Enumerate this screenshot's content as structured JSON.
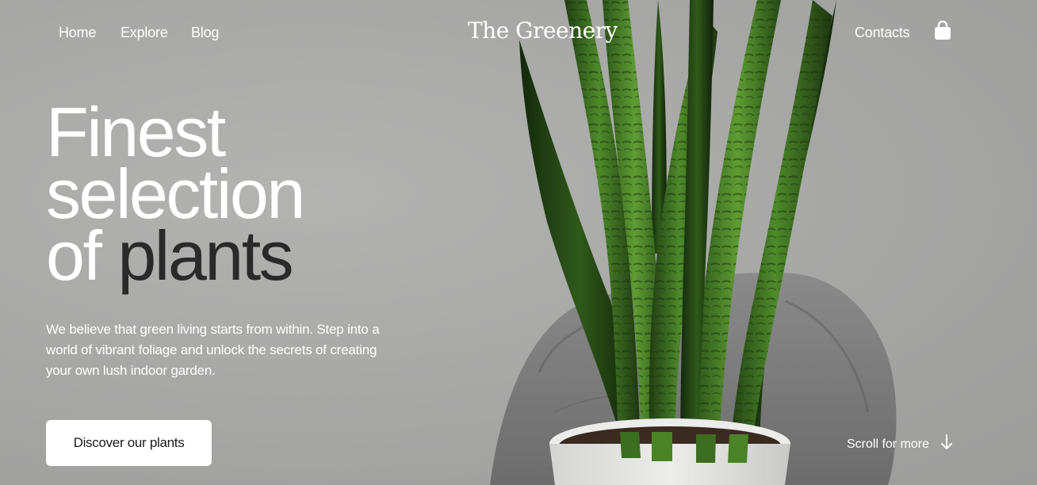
{
  "nav": {
    "home": "Home",
    "explore": "Explore",
    "blog": "Blog",
    "contacts": "Contacts"
  },
  "brand": "The Greenery",
  "hero": {
    "headline_line1": "Finest",
    "headline_line2": "selection",
    "headline_line3_light": "of ",
    "headline_line3_dark": "plants",
    "lead": "We believe that green living starts from within. Step into a world of vibrant foliage and unlock the secrets of creating your own lush indoor garden.",
    "cta_label": "Discover our plants",
    "scroll_label": "Scroll for more"
  },
  "icons": {
    "cart": "shopping-bag-icon",
    "scroll": "arrow-down-icon"
  },
  "colors": {
    "background": "#a8a8a7",
    "text_light": "#ffffff",
    "text_dark": "#2a2a2a",
    "leaf_green": "#3f7a22"
  }
}
